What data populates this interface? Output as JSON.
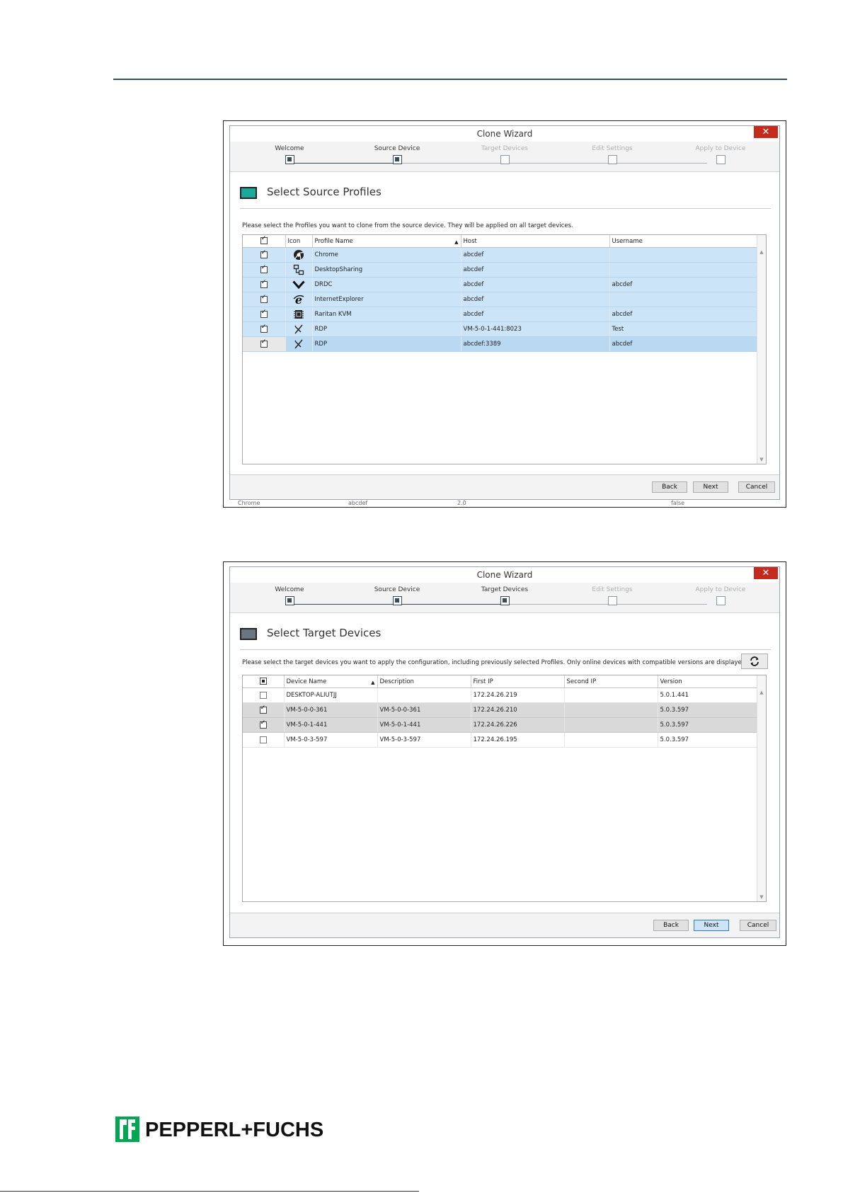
{
  "wizard_title": "Clone Wizard",
  "close_glyph": "✕",
  "steps": [
    "Welcome",
    "Source Device",
    "Target Devices",
    "Edit Settings",
    "Apply to Device"
  ],
  "buttons": {
    "back": "Back",
    "next": "Next",
    "cancel": "Cancel"
  },
  "screen1": {
    "heading": "Select Source Profiles",
    "instruction": "Please select the Profiles you want to clone from the source device. They will be applied on all target devices.",
    "columns": [
      "Icon",
      "Profile Name",
      "Host",
      "Username"
    ],
    "rows": [
      {
        "checked": true,
        "icon": "chrome-icon",
        "name": "Chrome",
        "host": "abcdef",
        "user": ""
      },
      {
        "checked": true,
        "icon": "desktop-sharing-icon",
        "name": "DesktopSharing",
        "host": "abcdef",
        "user": ""
      },
      {
        "checked": true,
        "icon": "drdc-chevron-icon",
        "name": "DRDC",
        "host": "abcdef",
        "user": "abcdef"
      },
      {
        "checked": true,
        "icon": "internet-explorer-icon",
        "name": "InternetExplorer",
        "host": "abcdef",
        "user": ""
      },
      {
        "checked": true,
        "icon": "raritan-kvm-icon",
        "name": "Raritan KVM",
        "host": "abcdef",
        "user": "abcdef"
      },
      {
        "checked": true,
        "icon": "rdp-icon",
        "name": "RDP",
        "host": "VM-5-0-1-441:8023",
        "user": "Test"
      },
      {
        "checked": true,
        "icon": "rdp-icon",
        "name": "RDP",
        "host": "abcdef:3389",
        "user": "abcdef"
      }
    ],
    "behind_text": [
      "Chrome",
      "abcdef",
      "2.0",
      "false"
    ]
  },
  "screen2": {
    "heading": "Select Target Devices",
    "instruction": "Please select the target devices you want to apply the configuration, including previously selected Profiles. Only online devices with compatible versions are displayed.",
    "refresh_icon": "refresh-icon",
    "columns": [
      "Device Name",
      "Description",
      "First IP",
      "Second IP",
      "Version"
    ],
    "rows": [
      {
        "checked": false,
        "name": "DESKTOP-ALIUTJJ",
        "desc": "",
        "ip1": "172.24.26.219",
        "ip2": "",
        "ver": "5.0.1.441"
      },
      {
        "checked": true,
        "name": "VM-5-0-0-361",
        "desc": "VM-5-0-0-361",
        "ip1": "172.24.26.210",
        "ip2": "",
        "ver": "5.0.3.597"
      },
      {
        "checked": true,
        "name": "VM-5-0-1-441",
        "desc": "VM-5-0-1-441",
        "ip1": "172.24.26.226",
        "ip2": "",
        "ver": "5.0.3.597"
      },
      {
        "checked": false,
        "name": "VM-5-0-3-597",
        "desc": "VM-5-0-3-597",
        "ip1": "172.24.26.195",
        "ip2": "",
        "ver": "5.0.3.597"
      }
    ]
  },
  "brand": "PEPPERL+FUCHS",
  "colors": {
    "accent_teal": "#1aa89a",
    "selection_blue": "#cce4f7",
    "close_red": "#c42b1c",
    "brand_green": "#00a651"
  }
}
